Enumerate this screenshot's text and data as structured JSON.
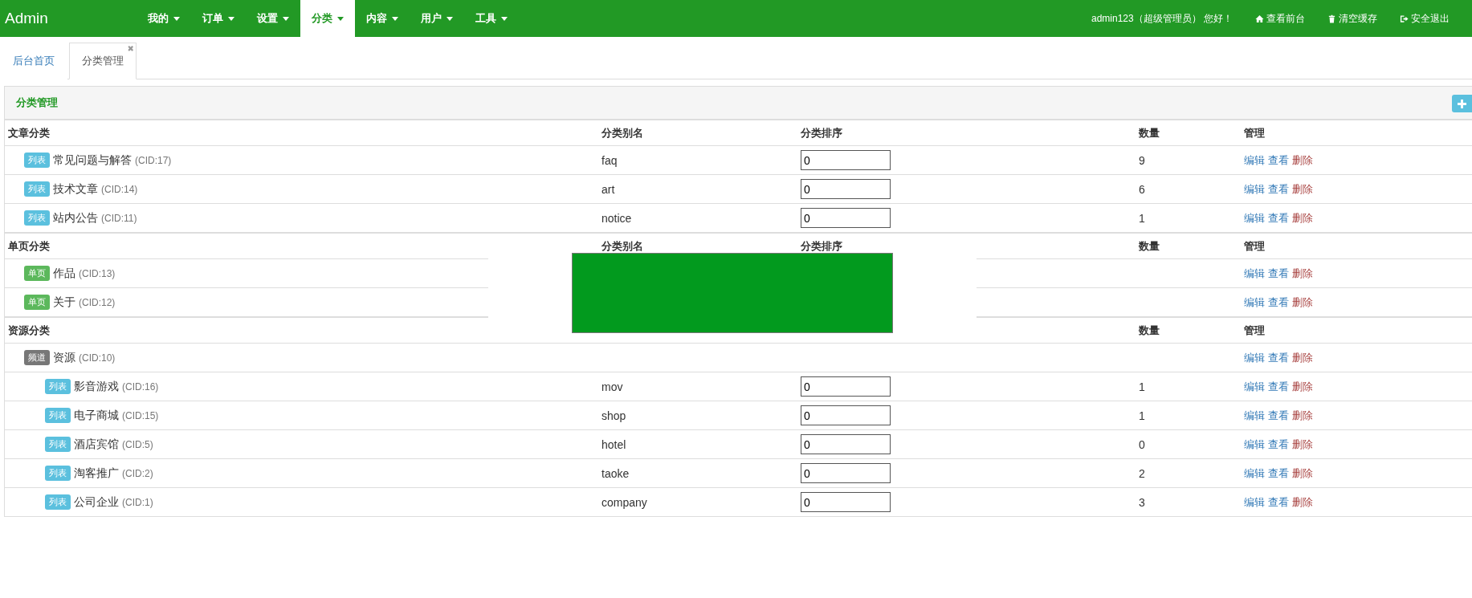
{
  "navbar": {
    "brand": "Admin",
    "menus": [
      {
        "label": "我的",
        "selected": false
      },
      {
        "label": "订单",
        "selected": false
      },
      {
        "label": "设置",
        "selected": false
      },
      {
        "label": "分类",
        "selected": true
      },
      {
        "label": "内容",
        "selected": false
      },
      {
        "label": "用户",
        "selected": false
      },
      {
        "label": "工具",
        "selected": false
      }
    ],
    "greeting": "admin123（超级管理员） 您好！",
    "links": [
      {
        "label": "查看前台",
        "kind": "home"
      },
      {
        "label": "清空缓存",
        "kind": "trash"
      },
      {
        "label": "安全退出",
        "kind": "logout"
      }
    ]
  },
  "tabs": [
    {
      "label": "后台首页",
      "selected": false
    },
    {
      "label": "分类管理",
      "selected": true,
      "close": "✖"
    }
  ],
  "panel": {
    "title": "分类管理",
    "groups": [
      {
        "headers": {
          "name": "文章分类",
          "alias": "分类别名",
          "sort": "分类排序",
          "count": "数量",
          "manage": "管理"
        },
        "rows": [
          {
            "badge": {
              "label": "列表",
              "kind": "list"
            },
            "name": "常见问题与解答",
            "cid": "(CID:17)",
            "alias": "faq",
            "sort": "0",
            "count": "9",
            "actions": [
              {
                "label": "编辑",
                "kind": "edit"
              },
              {
                "label": "查看",
                "kind": "view"
              },
              {
                "label": "删除",
                "kind": "delete"
              }
            ]
          },
          {
            "badge": {
              "label": "列表",
              "kind": "list"
            },
            "name": "技术文章",
            "cid": "(CID:14)",
            "alias": "art",
            "sort": "0",
            "count": "6",
            "actions": [
              {
                "label": "编辑",
                "kind": "edit"
              },
              {
                "label": "查看",
                "kind": "view"
              },
              {
                "label": "删除",
                "kind": "delete"
              }
            ]
          },
          {
            "badge": {
              "label": "列表",
              "kind": "list"
            },
            "name": "站内公告",
            "cid": "(CID:11)",
            "alias": "notice",
            "sort": "0",
            "count": "1",
            "actions": [
              {
                "label": "编辑",
                "kind": "edit"
              },
              {
                "label": "查看",
                "kind": "view"
              },
              {
                "label": "删除",
                "kind": "delete"
              }
            ]
          }
        ]
      },
      {
        "headers": {
          "name": "单页分类",
          "alias": "分类别名",
          "sort": "分类排序",
          "count": "数量",
          "manage": "管理"
        },
        "rows": [
          {
            "badge": {
              "label": "单页",
              "kind": "page"
            },
            "name": "作品",
            "cid": "(CID:13)",
            "actions": [
              {
                "label": "编辑",
                "kind": "edit"
              },
              {
                "label": "查看",
                "kind": "view"
              },
              {
                "label": "删除",
                "kind": "delete"
              }
            ]
          },
          {
            "badge": {
              "label": "单页",
              "kind": "page"
            },
            "name": "关于",
            "cid": "(CID:12)",
            "actions": [
              {
                "label": "编辑",
                "kind": "edit"
              },
              {
                "label": "查看",
                "kind": "view"
              },
              {
                "label": "删除",
                "kind": "delete"
              }
            ]
          }
        ]
      },
      {
        "headers": {
          "name": "资源分类",
          "count": "数量",
          "manage": "管理"
        },
        "rows": [
          {
            "badge": {
              "label": "频道",
              "kind": "channel"
            },
            "name": "资源",
            "cid": "(CID:10)",
            "actions": [
              {
                "label": "编辑",
                "kind": "edit"
              },
              {
                "label": "查看",
                "kind": "view"
              },
              {
                "label": "删除",
                "kind": "delete"
              }
            ],
            "children": [
              {
                "badge": {
                  "label": "列表",
                  "kind": "list"
                },
                "name": "影音游戏",
                "cid": "(CID:16)",
                "alias": "mov",
                "sort": "0",
                "count": "1",
                "actions": [
                  {
                    "label": "编辑",
                    "kind": "edit"
                  },
                  {
                    "label": "查看",
                    "kind": "view"
                  },
                  {
                    "label": "删除",
                    "kind": "delete"
                  }
                ]
              },
              {
                "badge": {
                  "label": "列表",
                  "kind": "list"
                },
                "name": "电子商城",
                "cid": "(CID:15)",
                "alias": "shop",
                "sort": "0",
                "count": "1",
                "actions": [
                  {
                    "label": "编辑",
                    "kind": "edit"
                  },
                  {
                    "label": "查看",
                    "kind": "view"
                  },
                  {
                    "label": "删除",
                    "kind": "delete"
                  }
                ]
              },
              {
                "badge": {
                  "label": "列表",
                  "kind": "list"
                },
                "name": "酒店宾馆",
                "cid": "(CID:5)",
                "alias": "hotel",
                "sort": "0",
                "count": "0",
                "actions": [
                  {
                    "label": "编辑",
                    "kind": "edit"
                  },
                  {
                    "label": "查看",
                    "kind": "view"
                  },
                  {
                    "label": "删除",
                    "kind": "delete"
                  }
                ]
              },
              {
                "badge": {
                  "label": "列表",
                  "kind": "list"
                },
                "name": "淘客推广",
                "cid": "(CID:2)",
                "alias": "taoke",
                "sort": "0",
                "count": "2",
                "actions": [
                  {
                    "label": "编辑",
                    "kind": "edit"
                  },
                  {
                    "label": "查看",
                    "kind": "view"
                  },
                  {
                    "label": "删除",
                    "kind": "delete"
                  }
                ]
              },
              {
                "badge": {
                  "label": "列表",
                  "kind": "list"
                },
                "name": "公司企业",
                "cid": "(CID:1)",
                "alias": "company",
                "sort": "0",
                "count": "3",
                "actions": [
                  {
                    "label": "编辑",
                    "kind": "edit"
                  },
                  {
                    "label": "查看",
                    "kind": "view"
                  },
                  {
                    "label": "删除",
                    "kind": "delete"
                  }
                ]
              }
            ]
          }
        ]
      }
    ]
  }
}
